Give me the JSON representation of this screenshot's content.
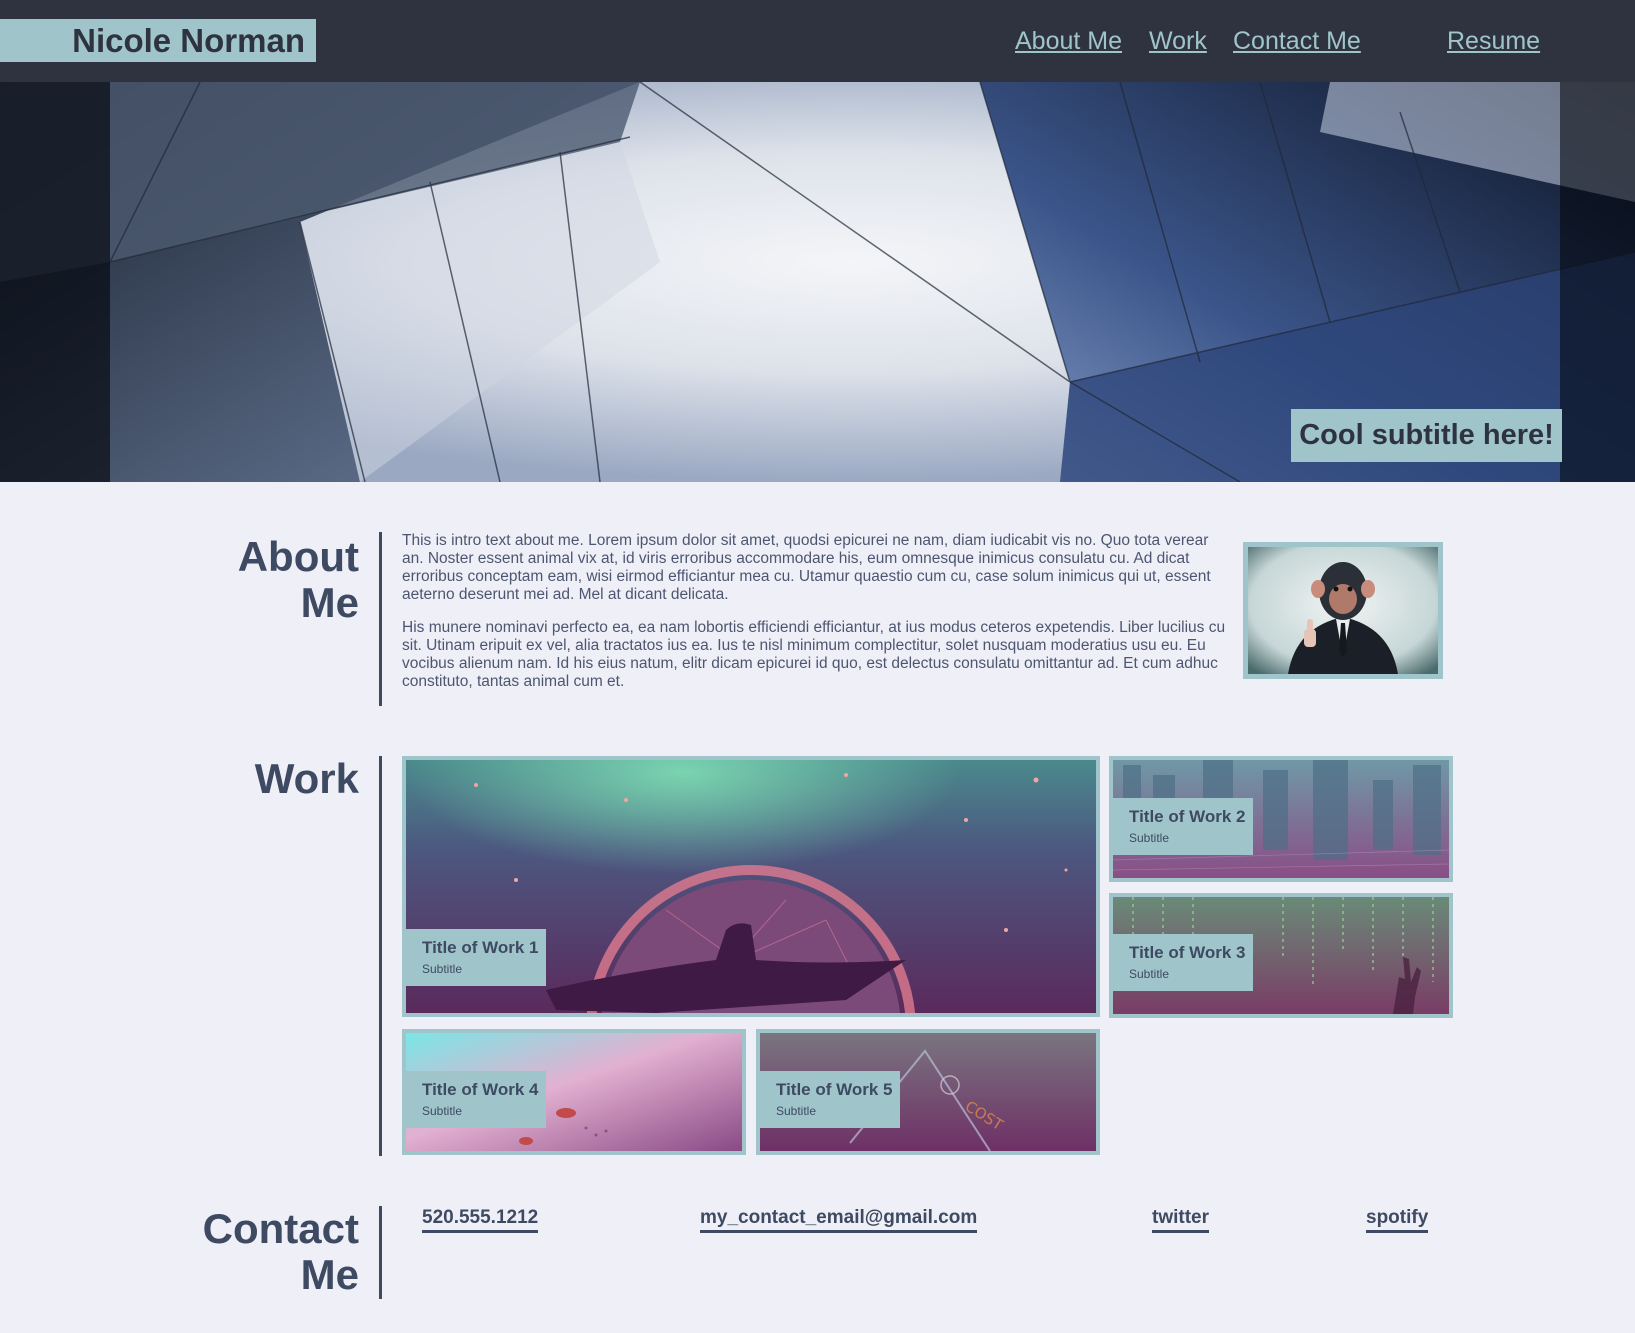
{
  "header": {
    "name": "Nicole Norman",
    "nav": [
      "About Me",
      "Work",
      "Contact Me",
      "Resume"
    ]
  },
  "hero": {
    "subtitle": "Cool subtitle here!"
  },
  "about": {
    "title_line1": "About",
    "title_line2": "Me",
    "paragraphs": [
      "This is intro text about me. Lorem ipsum dolor sit amet, quodsi epicurei ne nam, diam iudicabit vis no. Quo tota verear an. Noster essent animal vix at, id viris erroribus accommodare his, eum omnesque inimicus consulatu cu. Ad dicat erroribus conceptam eam, wisi eirmod efficiantur mea cu. Utamur quaestio cum cu, case solum inimicus qui ut, essent aeterno deserunt mei ad. Mel at dicant delicata.",
      "His munere nominavi perfecto ea, ea nam lobortis efficiendi efficiantur, at ius modus ceteros expetendis. Liber lucilius cu sit. Utinam eripuit ex vel, alia tractatos ius ea. Ius te nisl minimum complectitur, solet nusquam moderatius usu eu. Eu vocibus alienum nam. Id his eius natum, elitr dicam epicurei id quo, est delectus consulatu omittantur ad. Et cum adhuc constituto, tantas animal cum et."
    ]
  },
  "work": {
    "title": "Work",
    "items": [
      {
        "title": "Title of Work 1",
        "subtitle": "Subtitle"
      },
      {
        "title": "Title of Work 2",
        "subtitle": "Subtitle"
      },
      {
        "title": "Title of Work 3",
        "subtitle": "Subtitle"
      },
      {
        "title": "Title of Work 4",
        "subtitle": "Subtitle"
      },
      {
        "title": "Title of Work 5",
        "subtitle": "Subtitle"
      }
    ]
  },
  "contact": {
    "title_line1": "Contact",
    "title_line2": "Me",
    "phone": "520.555.1212",
    "email": "my_contact_email@gmail.com",
    "twitter": "twitter",
    "spotify": "spotify"
  },
  "colors": {
    "header_bg": "#2f333f",
    "accent": "#9fc5cb",
    "text": "#3e4a62",
    "page_bg": "#efeff7"
  }
}
